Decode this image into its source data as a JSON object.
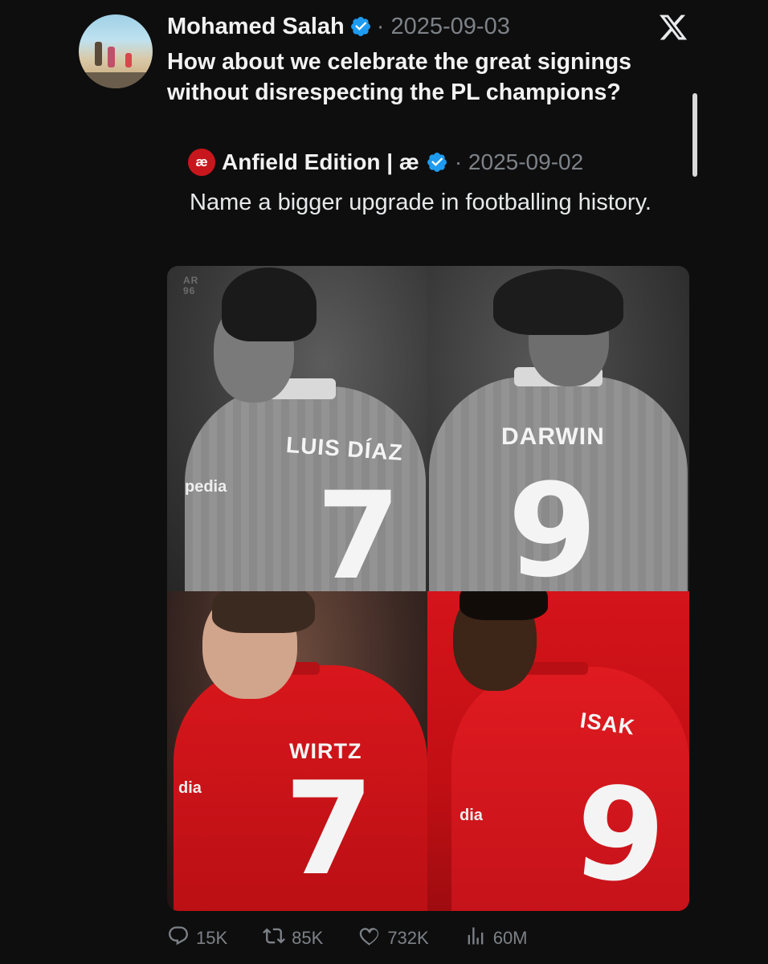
{
  "tweet": {
    "author_name": "Mohamed Salah",
    "date": "· 2025-09-03",
    "text": "How about we celebrate the great signings without disrespecting the PL champions?"
  },
  "quoted_tweet": {
    "author_avatar_letters": "æ",
    "author_name": "Anfield Edition | æ",
    "date": "· 2025-09-02",
    "text": "Name a bigger upgrade in footballing history."
  },
  "media": {
    "watermark": "AR\n96",
    "panels": [
      {
        "player_name": "LUIS DÍAZ",
        "number": "7",
        "sponsor": "pedia",
        "tone": "grey"
      },
      {
        "player_name": "DARWIN",
        "number": "9",
        "sponsor": "",
        "tone": "grey"
      },
      {
        "player_name": "WIRTZ",
        "number": "7",
        "sponsor": "dia",
        "tone": "red"
      },
      {
        "player_name": "ISAK",
        "number": "9",
        "sponsor": "dia",
        "tone": "red"
      }
    ]
  },
  "actions": {
    "replies": "15K",
    "reposts": "85K",
    "likes": "732K",
    "views": "60M"
  },
  "icons": {
    "verified": "verified-badge-icon",
    "x_logo": "x-logo-icon",
    "reply": "reply-icon",
    "repost": "repost-icon",
    "like": "heart-icon",
    "views": "views-icon"
  },
  "colors": {
    "background": "#0e0e0e",
    "verified": "#1d9bf0",
    "muted_text": "#7d8288",
    "liverpool_red": "#c8161d"
  }
}
